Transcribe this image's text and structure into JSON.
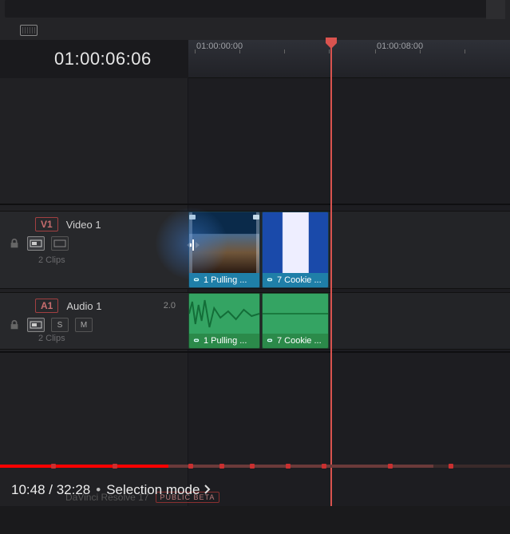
{
  "timecode_display": "01:00:06:06",
  "ruler": {
    "labels": [
      "01:00:00:00",
      "01:00:08:00"
    ]
  },
  "tracks": {
    "video": {
      "badge": "V1",
      "name": "Video 1",
      "clip_count_label": "2 Clips"
    },
    "audio": {
      "badge": "A1",
      "name": "Audio 1",
      "channels": "2.0",
      "clip_count_label": "2 Clips"
    }
  },
  "clips": {
    "v1": {
      "label": "1 Pulling ..."
    },
    "v2": {
      "label": "7 Cookie ..."
    },
    "a1": {
      "label": "1 Pulling ..."
    },
    "a2": {
      "label": "7 Cookie ..."
    }
  },
  "player": {
    "time_current": "10:48",
    "time_total": "32:28",
    "chapter_title": "Selection mode",
    "watermark_app": "DaVinci Resolve 17",
    "watermark_badge": "PUBLIC BETA"
  }
}
